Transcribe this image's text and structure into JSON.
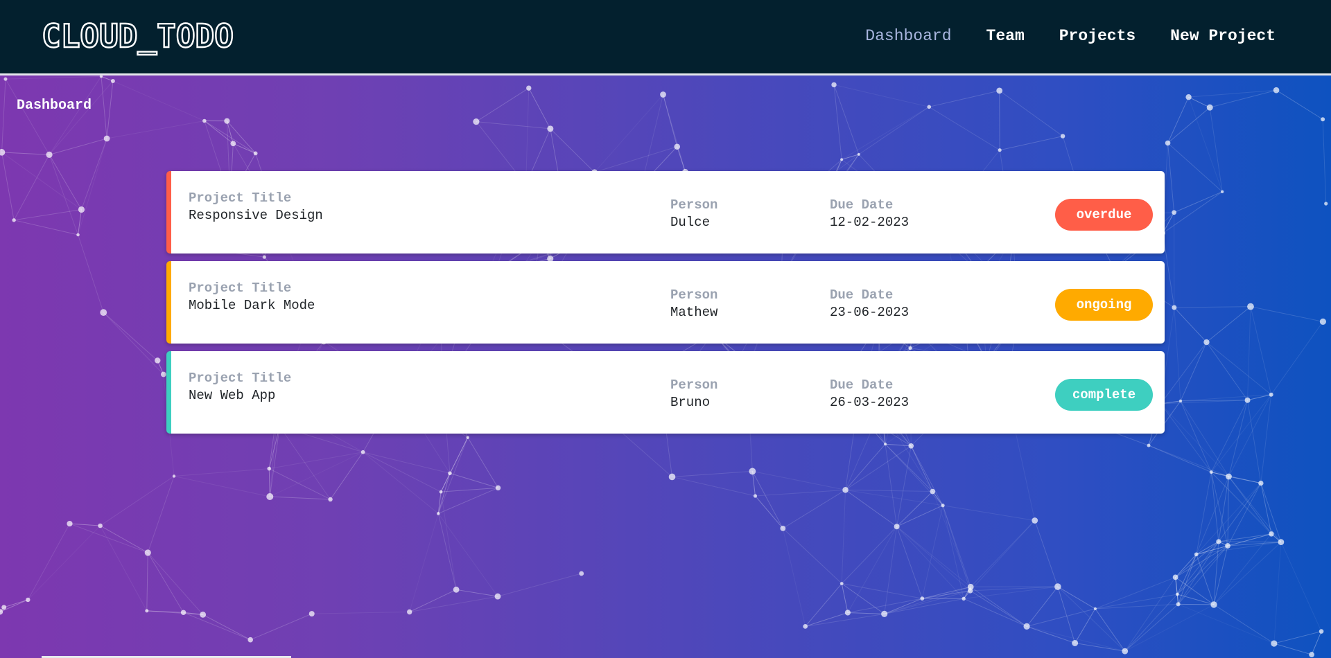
{
  "app": {
    "logo": "CLOUD_TODO"
  },
  "nav": {
    "items": [
      {
        "label": "Dashboard",
        "active": true
      },
      {
        "label": "Team",
        "active": false
      },
      {
        "label": "Projects",
        "active": false
      },
      {
        "label": "New Project",
        "active": false
      }
    ]
  },
  "page": {
    "title": "Dashboard"
  },
  "projects": [
    {
      "title_label": "Project Title",
      "title": "Responsive Design",
      "person_label": "Person",
      "person": "Dulce",
      "due_label": "Due Date",
      "due": "12-02-2023",
      "status": "overdue"
    },
    {
      "title_label": "Project Title",
      "title": "Mobile Dark Mode",
      "person_label": "Person",
      "person": "Mathew",
      "due_label": "Due Date",
      "due": "23-06-2023",
      "status": "ongoing"
    },
    {
      "title_label": "Project Title",
      "title": "New Web App",
      "person_label": "Person",
      "person": "Bruno",
      "due_label": "Due Date",
      "due": "26-03-2023",
      "status": "complete"
    }
  ],
  "colors": {
    "navbar": "#03202e",
    "overdue": "#ff5e48",
    "ongoing": "#ffaa00",
    "complete": "#3ecfc0",
    "nav_active": "#a9b6df"
  }
}
